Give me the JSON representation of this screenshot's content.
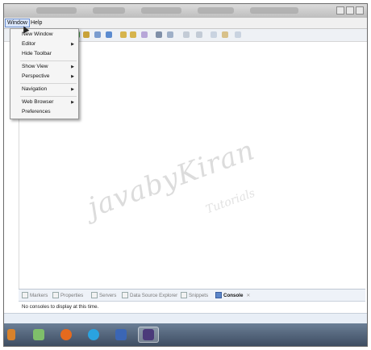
{
  "menubar": {
    "window_label": "Window",
    "help_label": "Help"
  },
  "window_menu": {
    "items": [
      {
        "label": "New Window",
        "submenu": false
      },
      {
        "label": "Editor",
        "submenu": true
      },
      {
        "label": "Hide Toolbar",
        "submenu": false
      },
      {
        "label": "Show View",
        "submenu": true
      },
      {
        "label": "Perspective",
        "submenu": true
      },
      {
        "label": "Navigation",
        "submenu": true
      },
      {
        "label": "Web Browser",
        "submenu": true
      },
      {
        "label": "Preferences",
        "submenu": false
      }
    ]
  },
  "views": {
    "tabs": [
      {
        "label": "Markers",
        "icon": "markers-icon"
      },
      {
        "label": "Properties",
        "icon": "properties-icon"
      },
      {
        "label": "Servers",
        "icon": "servers-icon"
      },
      {
        "label": "Data Source Explorer",
        "icon": "data-source-icon"
      },
      {
        "label": "Snippets",
        "icon": "snippets-icon"
      },
      {
        "label": "Console",
        "icon": "console-icon",
        "active": true
      }
    ],
    "console_message": "No consoles to display at this time."
  },
  "watermark": {
    "line1": "javabyKiran",
    "line2": "Tutorials"
  },
  "colors": {
    "accent": "#5c86c9",
    "taskbar": "#4a5a70",
    "menu_highlight": "#dbe7fb"
  }
}
